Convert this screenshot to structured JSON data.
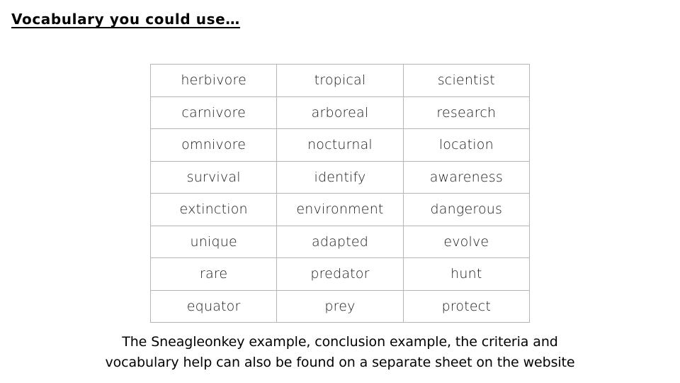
{
  "slide": {
    "title": "Vocabulary you could use…",
    "background_color": "#ffffff",
    "text_color": "#000000"
  },
  "vocab_table": {
    "border_color": "#b5b5b5",
    "outer_border_color": "#9a9a9a",
    "columns": 3,
    "rows_count": 8,
    "rows": [
      [
        "herbivore",
        "tropical",
        "scientist"
      ],
      [
        "carnivore",
        "arboreal",
        "research"
      ],
      [
        "omnivore",
        "nocturnal",
        "location"
      ],
      [
        "survival",
        "identify",
        "awareness"
      ],
      [
        "extinction",
        "environment",
        "dangerous"
      ],
      [
        "unique",
        "adapted",
        "evolve"
      ],
      [
        "rare",
        "predator",
        "hunt"
      ],
      [
        "equator",
        "prey",
        "protect"
      ]
    ]
  },
  "caption": {
    "line1": "The Sneagleonkey example, conclusion example,  the criteria and",
    "line2": "vocabulary help can also be found on a separate sheet on the website"
  }
}
